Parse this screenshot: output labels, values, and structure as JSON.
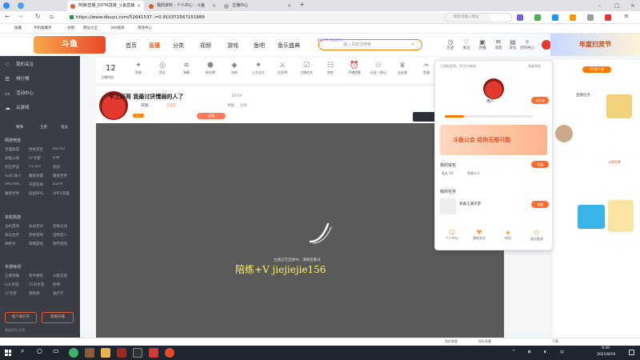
{
  "browser": {
    "tabs": [
      {
        "title": "阿狼i直播_DOTA直播_斗鱼直播",
        "close": "×"
      },
      {
        "title": "我的资料 - 个人中心 - 斗鱼",
        "close": "×"
      },
      {
        "title": "主播中心",
        "close": "×"
      }
    ],
    "new_tab": "+",
    "nav": {
      "back": "←",
      "forward": "→",
      "reload": "↻",
      "home": "⌂"
    },
    "url": "https://www.douyu.com/52641537 ;=0.910372567151889",
    "search_placeholder": "搜索或输入网址",
    "bookmarks": [
      "收藏",
      "手机收藏夹",
      "谷歌",
      "网址大全",
      "360搜索",
      "游戏中心"
    ]
  },
  "header": {
    "logo": "斗鱼",
    "nav": [
      "首页",
      "直播",
      "分类",
      "视频",
      "游戏",
      "鱼吧",
      "鱼乐盛典"
    ],
    "promo": "游戏分享 领免费好礼",
    "search_placeholder": "输入关键词搜索",
    "icons": [
      {
        "icon": "clock-icon",
        "label": "历史"
      },
      {
        "icon": "heart-icon",
        "label": "关注"
      },
      {
        "icon": "video-icon",
        "label": "开播"
      },
      {
        "icon": "bell-icon",
        "label": "消息"
      },
      {
        "icon": "briefcase-icon",
        "label": "背包"
      },
      {
        "icon": "pin-icon",
        "label": "创作中心"
      }
    ],
    "banner": "年度扫货节"
  },
  "sidebar": {
    "top": [
      {
        "icon": "heart-icon",
        "label": "我的关注"
      },
      {
        "icon": "list-icon",
        "label": "排行榜"
      },
      {
        "icon": "ticket-icon",
        "label": "活动中心"
      },
      {
        "icon": "cloud-icon",
        "label": "云游戏"
      }
    ],
    "shortcuts": [
      "赛事",
      "王者",
      "电竞"
    ],
    "sections": [
      {
        "title": "网游竞技",
        "items": [
          "英雄联盟",
          "绝地求生",
          "DOTA2",
          "穿越火线",
          "CF手游",
          "DNF",
          "炉石传说",
          "CS:GO",
          "逆战",
          "SuEC真人",
          "魔兽争霸",
          "魔兽世界",
          "VALORA...",
          "守望先锋",
          "DOTA",
          "魔兽世界",
          "团战RPG",
          "APEX英雄"
        ]
      },
      {
        "title": "单机热游",
        "items": [
          "主机游戏",
          "永劫无间",
          "恐怖之间",
          "骑兵生存",
          "恐怖游戏",
          "怪物猎人",
          "神枪手",
          "策略游戏",
          "情怀游戏"
        ]
      },
      {
        "title": "手游休闲",
        "items": [
          "王者荣耀",
          "和平精英",
          "火影忍者",
          "LOL手游",
          "COD手游",
          "原神",
          "CF手游",
          "阴阳师",
          "金铲铲"
        ]
      }
    ],
    "buttons": [
      "客户端打开",
      "我要开播"
    ],
    "footer": "超级会员  反馈"
  },
  "giftbar": {
    "count": "12",
    "count_label": "主播特权",
    "items": [
      "鱼翅",
      "鱼丸",
      "弹幕",
      "粉丝牌",
      "钻粉",
      "火力全开",
      "全民PK",
      "主播任务",
      "鱼吧",
      "开播提醒",
      "水友一起玩",
      "水友赛",
      "鱼塘"
    ]
  },
  "room": {
    "title": "早上好哥 我最讨厌懦弱的人了",
    "tag": "DOTA",
    "level": "LV.1",
    "streamer": "阿狼i",
    "hot": "3.2万",
    "report": "举报",
    "share": "分享",
    "subscribe": "订阅"
  },
  "player": {
    "overlay": "陪练+V  jiejiejie156",
    "loading": "主播正在连接中，请稍后重试"
  },
  "panel": {
    "notice": "已领取签到，26天内有效",
    "vip": "贵族特权",
    "username": "用户",
    "level_btn": "去升级",
    "banner": "斗鱼公会 给你无限可能",
    "wallet_title": "我的钱包",
    "fish_balls": "鱼丸 94",
    "fish_fins": "鱼翅 4.2",
    "recharge": "充值",
    "task_title": "我的任务",
    "task_name": "装备江湖页游",
    "task_btn": "领取",
    "actions": [
      "个人中心",
      "我的关注",
      "钱包",
      "退出登录"
    ]
  },
  "rightrail": {
    "label": "直播任务",
    "ad": "斗鱼世界",
    "badge": "PC客户端"
  },
  "statusbar": [
    "我的观看",
    "网址收藏",
    "下载"
  ],
  "taskbar": {
    "time": "9:30",
    "date": "2021/8/19",
    "start_icon": "windows-icon"
  }
}
